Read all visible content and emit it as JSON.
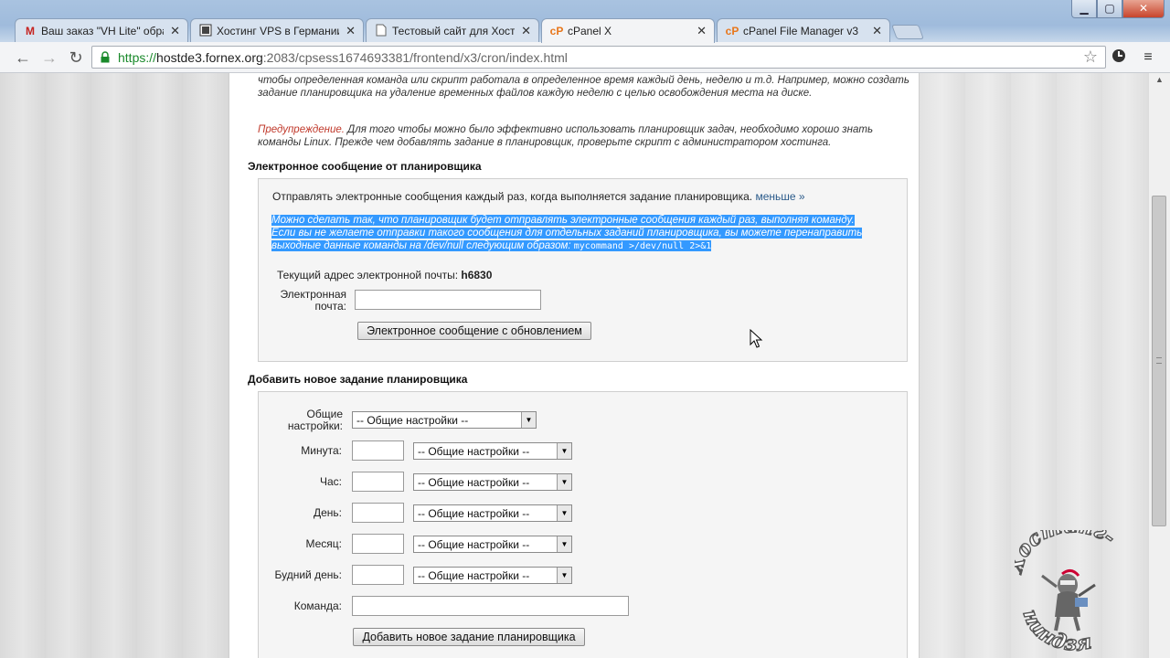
{
  "browser": {
    "tabs": [
      {
        "title": "Ваш заказ \"VH Lite\" обра",
        "icon": "gmail-icon",
        "active": false
      },
      {
        "title": "Хостинг VPS в Германии",
        "icon": "site-icon",
        "active": false
      },
      {
        "title": "Тестовый сайт для Хости",
        "icon": "page-icon",
        "active": false
      },
      {
        "title": "cPanel X",
        "icon": "cpanel-icon",
        "active": true
      },
      {
        "title": "cPanel File Manager v3",
        "icon": "cpanel-icon",
        "active": false
      }
    ],
    "url_scheme": "https://",
    "url_host": "hostde3.fornex.org",
    "url_path": ":2083/cpsess1674693381/frontend/x3/cron/index.html"
  },
  "intro": {
    "paragraph": "чтобы определенная команда или скрипт работала в определенное время каждый день, неделю и т.д. Например, можно создать задание планировщика на удаление временных файлов каждую неделю с целью освобождения места на диске.",
    "warning_label": "Предупреждение.",
    "warning_text": " Для того чтобы можно было эффективно использовать планировщик задач, необходимо хорошо знать команды Linux. Прежде чем добавлять задание в планировщик, проверьте скрипт с администратором хостинга."
  },
  "email_section": {
    "title": "Электронное сообщение от планировщика",
    "description": "Отправлять электронные сообщения каждый раз, когда выполняется задание планировщика.",
    "less_link": "меньше »",
    "details_line1": "Можно сделать так, что планировщик будет отправлять электронные сообщения каждый раз, выполняя команду.",
    "details_line2": "Если вы не желаете отправки такого сообщения для отдельных заданий планировщика, вы можете перенаправить",
    "details_line3": "выходные данные команды на /dev/null следующим образом:",
    "details_code": "mycommand >/dev/null 2>&1",
    "current_email_label": "Текущий адрес электронной почты:",
    "current_email_value": "h6830",
    "email_label": "Электронная почта:",
    "email_value": "",
    "update_button": "Электронное сообщение с обновлением"
  },
  "cron_section": {
    "title": "Добавить новое задание планировщика",
    "common_settings_label": "Общие настройки:",
    "common_settings_value": "-- Общие настройки --",
    "fields": [
      {
        "label": "Минута:",
        "value": "",
        "select": "-- Общие настройки --"
      },
      {
        "label": "Час:",
        "value": "",
        "select": "-- Общие настройки --"
      },
      {
        "label": "День:",
        "value": "",
        "select": "-- Общие настройки --"
      },
      {
        "label": "Месяц:",
        "value": "",
        "select": "-- Общие настройки --"
      },
      {
        "label": "Будний день:",
        "value": "",
        "select": "-- Общие настройки --"
      }
    ],
    "command_label": "Команда:",
    "command_value": "",
    "add_button": "Добавить новое задание планировщика"
  },
  "watermark": {
    "top_text": "Хостинг-",
    "bottom_text": "ниндзя"
  },
  "colors": {
    "selection": "#3399ff",
    "warning": "#c0392b",
    "https_green": "#1a8a2b",
    "link": "#2a5a8a"
  }
}
